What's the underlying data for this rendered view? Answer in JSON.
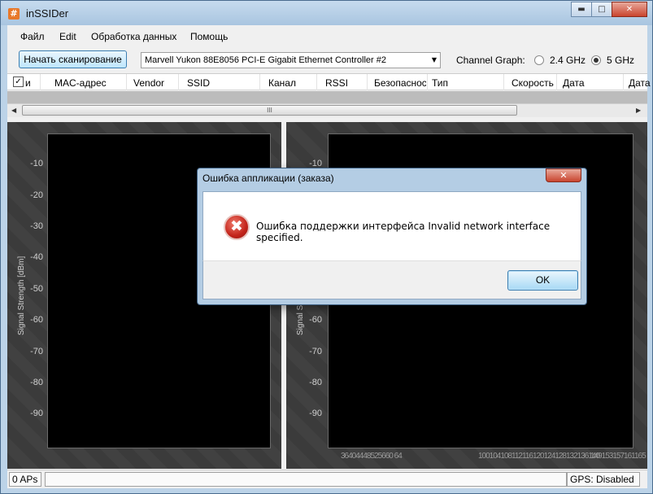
{
  "window": {
    "title": "inSSIDer",
    "icon": "hash-icon",
    "btn_minimize": "▬",
    "btn_maximize": "□",
    "btn_close": "✕"
  },
  "menu": [
    {
      "label": "Файл"
    },
    {
      "label": "Edit"
    },
    {
      "label": "Обработка данных"
    },
    {
      "label": "Помощь"
    }
  ],
  "toolbar": {
    "scan_label": "Начать сканирование",
    "adapter": "Marvell Yukon 88E8056 PCI-E Gigabit Ethernet Controller #2",
    "channel_graph_label": "Channel Graph:",
    "opt_24": "2.4 GHz",
    "opt_5": "5 GHz",
    "selected": "5 GHz"
  },
  "columns": [
    {
      "label": "и"
    },
    {
      "label": "MAC-адрес"
    },
    {
      "label": "Vendor"
    },
    {
      "label": "SSID"
    },
    {
      "label": "Канал"
    },
    {
      "label": "RSSI"
    },
    {
      "label": "Безопасность"
    },
    {
      "label": "Тип"
    },
    {
      "label": "Скорость"
    },
    {
      "label": "Дата"
    },
    {
      "label": "Дата"
    }
  ],
  "scrollbar": {
    "left": "◀",
    "right": "▶",
    "grip": "III"
  },
  "charts": {
    "y_label": "Signal Strength [dBm]",
    "y_ticks": [
      "-10",
      "-20",
      "-30",
      "-40",
      "-50",
      "-60",
      "-70",
      "-80",
      "-90"
    ],
    "x_ticks_left": "36404448525660 64",
    "x_ticks_right": "100104108112116120124128132136140",
    "x_ticks_right2": "149153157161165"
  },
  "status": {
    "aps": "0 APs",
    "gps": "GPS: Disabled"
  },
  "dialog": {
    "title": "Ошибка аппликации (заказа)",
    "close": "✕",
    "icon": "error-icon",
    "icon_glyph": "✖",
    "message": "Ошибка поддержки интерфейса Invalid network interface specified.",
    "ok_label": "OK"
  }
}
